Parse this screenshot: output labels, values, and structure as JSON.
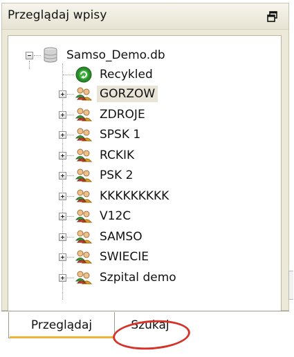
{
  "panel": {
    "title": "Przeglądaj wpisy",
    "restore_icon": "restore-window-icon"
  },
  "tree": {
    "root": {
      "label": "Samso_Demo.db",
      "icon": "database-icon",
      "expanded": true
    },
    "recycled": {
      "label": "Recykled",
      "icon": "recycle-icon"
    },
    "groups": [
      {
        "label": "GORZOW",
        "icon": "users-group-icon",
        "selected": true
      },
      {
        "label": "ZDROJE",
        "icon": "users-group-icon"
      },
      {
        "label": "SPSK 1",
        "icon": "users-group-icon"
      },
      {
        "label": "RCKIK",
        "icon": "users-group-icon"
      },
      {
        "label": "PSK 2",
        "icon": "users-group-icon"
      },
      {
        "label": "KKKKKKKKK",
        "icon": "users-group-icon"
      },
      {
        "label": "V12C",
        "icon": "users-group-icon"
      },
      {
        "label": "SAMSO",
        "icon": "users-group-icon"
      },
      {
        "label": "SWIECIE",
        "icon": "users-group-icon"
      },
      {
        "label": "Szpital demo",
        "icon": "users-group-icon"
      }
    ]
  },
  "tabs": [
    {
      "label": "Przeglądaj",
      "active": true
    },
    {
      "label": "Szukaj",
      "active": false,
      "highlighted": true
    }
  ],
  "colors": {
    "accent_tab": "#f2b23a",
    "highlight_circle": "#d4332a",
    "selected_row": "#e8e5d8"
  }
}
